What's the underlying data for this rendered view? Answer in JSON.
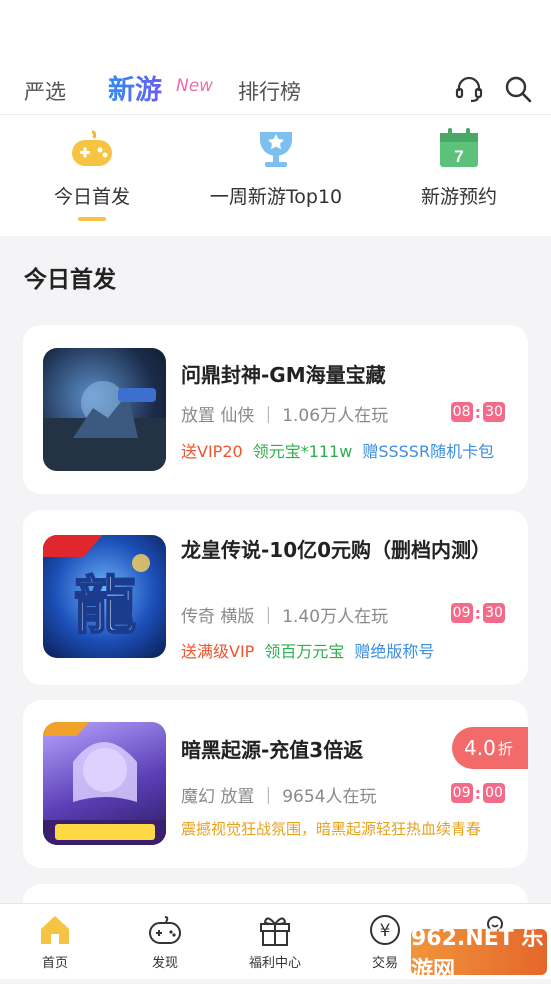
{
  "nav": {
    "yanxuan": "严选",
    "xinyou": "新游",
    "new_tag": "New",
    "paihangbang": "排行榜"
  },
  "tabs": [
    {
      "label": "今日首发",
      "icon": "gamepad-icon",
      "active": true
    },
    {
      "label": "一周新游Top10",
      "icon": "trophy-icon",
      "active": false
    },
    {
      "label": "新游预约",
      "icon": "calendar-icon",
      "calendar_day": "7",
      "active": false
    }
  ],
  "section_title": "今日首发",
  "games": [
    {
      "name": "问鼎封神-GM海量宝藏",
      "meta": "放置 仙侠 ｜ 1.06万人在玩",
      "time_h": "08",
      "time_m": "30",
      "perks": [
        {
          "text": "送VIP20",
          "color": "#f0532d"
        },
        {
          "text": "领元宝*111w",
          "color": "#2fae4f"
        },
        {
          "text": "赠SSSSR随机卡包",
          "color": "#3b8fe0"
        }
      ]
    },
    {
      "name": "龙皇传说-10亿0元购（删档内测）",
      "meta": "传奇 横版 ｜ 1.40万人在玩",
      "time_h": "09",
      "time_m": "30",
      "perks": [
        {
          "text": "送满级VIP",
          "color": "#f0532d"
        },
        {
          "text": "领百万元宝",
          "color": "#2fae4f"
        },
        {
          "text": "赠绝版称号",
          "color": "#3b8fe0"
        }
      ]
    },
    {
      "name": "暗黑起源-充值3倍返",
      "meta": "魔幻 放置 ｜ 9654人在玩",
      "time_h": "09",
      "time_m": "00",
      "discount": "4.0",
      "discount_unit": "折",
      "desc": "震撼视觉狂战氛围，暗黑起源轻狂热血续青春",
      "desc_color": "#e8a21c"
    }
  ],
  "bottom_nav": [
    {
      "label": "首页",
      "icon": "home-icon",
      "active": true
    },
    {
      "label": "发现",
      "icon": "gamepad-outline-icon",
      "active": false
    },
    {
      "label": "福利中心",
      "icon": "gift-icon",
      "active": false
    },
    {
      "label": "交易",
      "icon": "yuan-icon",
      "active": false
    },
    {
      "label": "",
      "icon": "profile-icon",
      "active": false
    }
  ],
  "watermark": "962.NET 乐游网",
  "colors": {
    "accent": "#f6c343",
    "time": "#f46b8a",
    "discount": "#f26a6a"
  }
}
